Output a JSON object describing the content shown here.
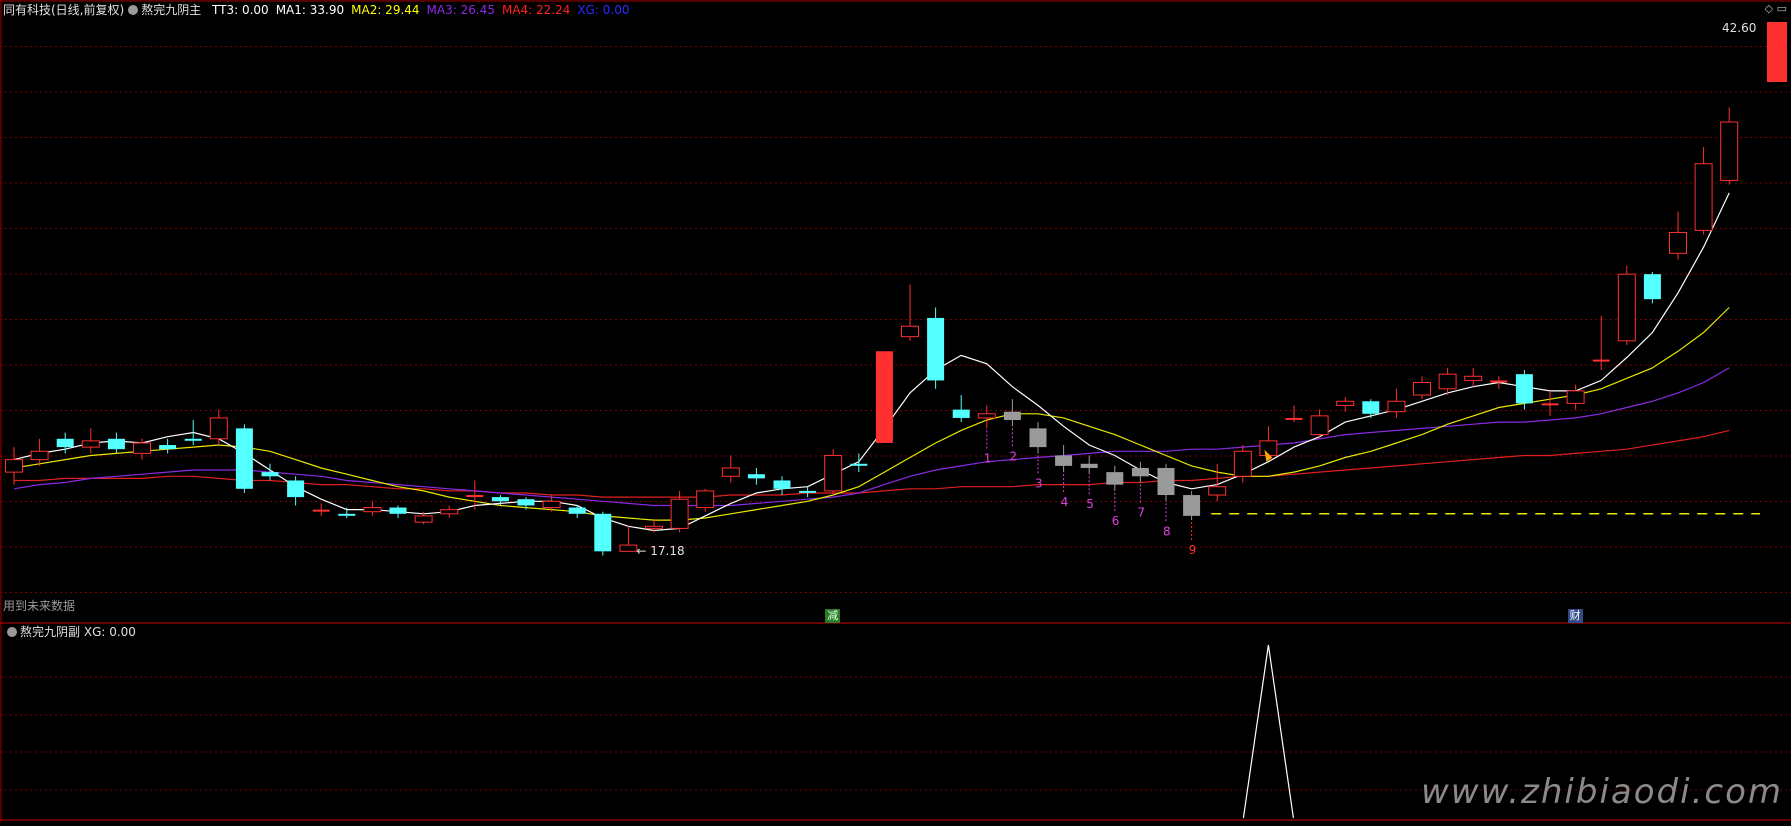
{
  "header": {
    "stock": "同有科技(日线,前复权)",
    "main_indicator": "熬完九阴主",
    "values": [
      {
        "label": "TT3: 0.00",
        "color": "#ffffff"
      },
      {
        "label": "MA1: 33.90",
        "color": "#ffffff"
      },
      {
        "label": "MA2: 29.44",
        "color": "#ffff00"
      },
      {
        "label": "MA3: 26.45",
        "color": "#8a2be2"
      },
      {
        "label": "MA4: 22.24",
        "color": "#ff2020"
      },
      {
        "label": "XG: 0.00",
        "color": "#2a2aff"
      }
    ],
    "corner_icons": "◇ ▭"
  },
  "sub_header": {
    "indicator": "熬完九阴副",
    "value": "XG: 0.00"
  },
  "labels": {
    "future_data": "用到未来数据",
    "high_price": "42.60",
    "low_price": "← 17.18",
    "badge_reduce": "减",
    "badge_wealth": "财",
    "watermark": "www.zhibiaodi.com"
  },
  "colors": {
    "up": "#ff3030",
    "down": "#54ffff",
    "grey": "#9a9a9a",
    "grid": "#7a0000",
    "ma1": "#ffffff",
    "ma2": "#e8e800",
    "ma3": "#8a2be2",
    "ma4": "#e02020",
    "count": "#e040e0",
    "count9": "#ff3030"
  },
  "chart_data": {
    "type": "candlestick",
    "ylim": [
      14,
      42.6
    ],
    "candles": [
      {
        "o": 21.0,
        "c": 21.6,
        "h": 22.2,
        "l": 20.4,
        "k": "up"
      },
      {
        "o": 21.6,
        "c": 22.0,
        "h": 22.6,
        "l": 21.3,
        "k": "up"
      },
      {
        "o": 22.6,
        "c": 22.2,
        "h": 22.9,
        "l": 21.9,
        "k": "down"
      },
      {
        "o": 22.2,
        "c": 22.5,
        "h": 23.1,
        "l": 21.9,
        "k": "up"
      },
      {
        "o": 22.6,
        "c": 22.1,
        "h": 22.9,
        "l": 21.9,
        "k": "down"
      },
      {
        "o": 21.9,
        "c": 22.4,
        "h": 22.6,
        "l": 21.6,
        "k": "up"
      },
      {
        "o": 22.3,
        "c": 22.1,
        "h": 22.6,
        "l": 21.9,
        "k": "down"
      },
      {
        "o": 22.6,
        "c": 22.6,
        "h": 23.5,
        "l": 22.3,
        "k": "doji"
      },
      {
        "o": 22.6,
        "c": 23.6,
        "h": 24.0,
        "l": 22.3,
        "k": "up"
      },
      {
        "o": 23.1,
        "c": 20.2,
        "h": 23.3,
        "l": 20.0,
        "k": "down"
      },
      {
        "o": 21.0,
        "c": 20.8,
        "h": 21.4,
        "l": 20.6,
        "k": "down"
      },
      {
        "o": 20.6,
        "c": 19.8,
        "h": 20.8,
        "l": 19.4,
        "k": "down"
      },
      {
        "o": 19.2,
        "c": 19.2,
        "h": 19.5,
        "l": 18.9,
        "k": "doji"
      },
      {
        "o": 19.0,
        "c": 19.0,
        "h": 19.3,
        "l": 18.8,
        "k": "doji"
      },
      {
        "o": 19.1,
        "c": 19.3,
        "h": 19.6,
        "l": 18.9,
        "k": "up"
      },
      {
        "o": 19.3,
        "c": 19.0,
        "h": 19.4,
        "l": 18.8,
        "k": "down"
      },
      {
        "o": 18.6,
        "c": 18.9,
        "h": 19.1,
        "l": 18.5,
        "k": "up"
      },
      {
        "o": 19.0,
        "c": 19.2,
        "h": 19.4,
        "l": 18.8,
        "k": "up"
      },
      {
        "o": 19.8,
        "c": 19.9,
        "h": 20.6,
        "l": 19.2,
        "k": "doji"
      },
      {
        "o": 19.8,
        "c": 19.6,
        "h": 19.9,
        "l": 19.4,
        "k": "down"
      },
      {
        "o": 19.7,
        "c": 19.4,
        "h": 19.8,
        "l": 19.2,
        "k": "down"
      },
      {
        "o": 19.3,
        "c": 19.6,
        "h": 19.9,
        "l": 19.1,
        "k": "up"
      },
      {
        "o": 19.3,
        "c": 19.0,
        "h": 19.4,
        "l": 18.8,
        "k": "down"
      },
      {
        "o": 19.0,
        "c": 17.2,
        "h": 19.1,
        "l": 17.0,
        "k": "down"
      },
      {
        "o": 17.5,
        "c": 17.2,
        "h": 18.4,
        "l": 17.18,
        "k": "up"
      },
      {
        "o": 18.3,
        "c": 18.4,
        "h": 18.7,
        "l": 18.1,
        "k": "up"
      },
      {
        "o": 18.3,
        "c": 19.7,
        "h": 20.1,
        "l": 18.1,
        "k": "up"
      },
      {
        "o": 19.3,
        "c": 20.1,
        "h": 20.2,
        "l": 19.1,
        "k": "up"
      },
      {
        "o": 20.8,
        "c": 21.2,
        "h": 21.8,
        "l": 20.5,
        "k": "up"
      },
      {
        "o": 20.9,
        "c": 20.7,
        "h": 21.2,
        "l": 20.4,
        "k": "down"
      },
      {
        "o": 20.6,
        "c": 20.2,
        "h": 20.8,
        "l": 19.9,
        "k": "down"
      },
      {
        "o": 20.1,
        "c": 20.1,
        "h": 20.3,
        "l": 19.8,
        "k": "doji"
      },
      {
        "o": 20.1,
        "c": 21.8,
        "h": 22.1,
        "l": 19.9,
        "k": "up"
      },
      {
        "o": 21.4,
        "c": 21.4,
        "h": 21.9,
        "l": 21.0,
        "k": "doji"
      },
      {
        "o": 22.4,
        "c": 26.8,
        "h": 26.8,
        "l": 22.4,
        "k": "limit"
      },
      {
        "o": 27.5,
        "c": 28.0,
        "h": 30.0,
        "l": 27.3,
        "k": "up"
      },
      {
        "o": 28.4,
        "c": 25.4,
        "h": 28.9,
        "l": 25.0,
        "k": "down"
      },
      {
        "o": 24.0,
        "c": 23.6,
        "h": 24.7,
        "l": 23.4,
        "k": "down"
      },
      {
        "o": 23.6,
        "c": 23.8,
        "h": 24.2,
        "l": 23.1,
        "k": "up"
      },
      {
        "o": 23.5,
        "c": 23.9,
        "h": 24.5,
        "l": 23.2,
        "k": "grey"
      },
      {
        "o": 23.1,
        "c": 22.2,
        "h": 23.4,
        "l": 21.9,
        "k": "grey"
      },
      {
        "o": 21.8,
        "c": 21.3,
        "h": 22.3,
        "l": 21.0,
        "k": "grey"
      },
      {
        "o": 21.4,
        "c": 21.2,
        "h": 21.8,
        "l": 20.9,
        "k": "grey"
      },
      {
        "o": 21.0,
        "c": 20.4,
        "h": 21.3,
        "l": 20.1,
        "k": "grey"
      },
      {
        "o": 21.2,
        "c": 20.8,
        "h": 21.5,
        "l": 20.5,
        "k": "grey"
      },
      {
        "o": 21.2,
        "c": 19.9,
        "h": 21.4,
        "l": 19.6,
        "k": "grey"
      },
      {
        "o": 19.9,
        "c": 18.9,
        "h": 20.1,
        "l": 18.7,
        "k": "grey"
      },
      {
        "o": 19.9,
        "c": 20.3,
        "h": 21.4,
        "l": 19.6,
        "k": "up"
      },
      {
        "o": 20.8,
        "c": 22.0,
        "h": 22.3,
        "l": 20.5,
        "k": "up"
      },
      {
        "o": 21.8,
        "c": 22.5,
        "h": 23.2,
        "l": 21.6,
        "k": "up"
      },
      {
        "o": 23.6,
        "c": 23.6,
        "h": 24.2,
        "l": 23.4,
        "k": "doji"
      },
      {
        "o": 22.8,
        "c": 23.7,
        "h": 24.0,
        "l": 22.6,
        "k": "up"
      },
      {
        "o": 24.2,
        "c": 24.4,
        "h": 24.6,
        "l": 23.9,
        "k": "up"
      },
      {
        "o": 24.4,
        "c": 23.8,
        "h": 24.5,
        "l": 23.6,
        "k": "down"
      },
      {
        "o": 23.9,
        "c": 24.4,
        "h": 25.0,
        "l": 23.6,
        "k": "up"
      },
      {
        "o": 24.7,
        "c": 25.3,
        "h": 25.6,
        "l": 24.5,
        "k": "up"
      },
      {
        "o": 25.0,
        "c": 25.7,
        "h": 26.0,
        "l": 24.7,
        "k": "up"
      },
      {
        "o": 25.4,
        "c": 25.6,
        "h": 26.0,
        "l": 25.1,
        "k": "up"
      },
      {
        "o": 25.4,
        "c": 25.3,
        "h": 25.6,
        "l": 25.0,
        "k": "doji"
      },
      {
        "o": 25.7,
        "c": 24.3,
        "h": 25.9,
        "l": 24.0,
        "k": "down"
      },
      {
        "o": 24.3,
        "c": 24.3,
        "h": 24.9,
        "l": 23.7,
        "k": "doji"
      },
      {
        "o": 24.3,
        "c": 24.9,
        "h": 25.2,
        "l": 24.0,
        "k": "up"
      },
      {
        "o": 26.4,
        "c": 26.4,
        "h": 28.5,
        "l": 25.9,
        "k": "doji"
      },
      {
        "o": 27.3,
        "c": 30.5,
        "h": 30.9,
        "l": 27.1,
        "k": "up"
      },
      {
        "o": 30.5,
        "c": 29.3,
        "h": 30.6,
        "l": 29.1,
        "k": "down"
      },
      {
        "o": 31.5,
        "c": 32.5,
        "h": 33.5,
        "l": 31.2,
        "k": "up"
      },
      {
        "o": 32.6,
        "c": 35.8,
        "h": 36.6,
        "l": 32.4,
        "k": "up"
      },
      {
        "o": 35.0,
        "c": 37.8,
        "h": 38.5,
        "l": 34.8,
        "k": "up"
      }
    ],
    "ma1": [
      21.6,
      21.9,
      22.1,
      22.4,
      22.5,
      22.4,
      22.7,
      22.9,
      22.6,
      21.9,
      21.1,
      20.3,
      19.7,
      19.2,
      19.2,
      19.1,
      19.0,
      19.1,
      19.4,
      19.5,
      19.6,
      19.6,
      19.4,
      18.8,
      18.4,
      18.2,
      18.3,
      18.9,
      19.5,
      20.0,
      20.2,
      20.3,
      20.9,
      21.5,
      23.1,
      24.8,
      25.9,
      26.6,
      26.2,
      25.1,
      24.2,
      23.2,
      22.3,
      21.8,
      21.1,
      20.5,
      20.2,
      20.4,
      20.9,
      21.5,
      22.2,
      22.7,
      23.4,
      23.7,
      24.0,
      24.4,
      24.8,
      25.1,
      25.3,
      25.1,
      24.9,
      24.9,
      25.4,
      26.5,
      27.7,
      29.6,
      31.8,
      34.4
    ],
    "ma2": [
      21.2,
      21.4,
      21.6,
      21.8,
      21.9,
      22.0,
      22.1,
      22.2,
      22.3,
      22.2,
      22.0,
      21.6,
      21.2,
      20.9,
      20.6,
      20.3,
      20.1,
      19.8,
      19.6,
      19.4,
      19.3,
      19.2,
      19.1,
      18.9,
      18.8,
      18.7,
      18.7,
      18.8,
      19.0,
      19.2,
      19.4,
      19.6,
      19.9,
      20.3,
      21.0,
      21.7,
      22.4,
      23.0,
      23.5,
      23.8,
      23.8,
      23.6,
      23.2,
      22.8,
      22.3,
      21.8,
      21.3,
      21.0,
      20.8,
      20.8,
      21.0,
      21.3,
      21.7,
      22.0,
      22.4,
      22.8,
      23.3,
      23.7,
      24.1,
      24.3,
      24.5,
      24.7,
      25.0,
      25.5,
      26.0,
      26.8,
      27.7,
      28.9
    ],
    "ma3": [
      20.2,
      20.4,
      20.5,
      20.7,
      20.8,
      20.9,
      21.0,
      21.1,
      21.1,
      21.1,
      21.0,
      20.9,
      20.8,
      20.6,
      20.5,
      20.4,
      20.3,
      20.2,
      20.1,
      20.0,
      19.9,
      19.8,
      19.7,
      19.6,
      19.5,
      19.4,
      19.4,
      19.4,
      19.4,
      19.5,
      19.6,
      19.7,
      19.8,
      20.0,
      20.4,
      20.8,
      21.1,
      21.3,
      21.5,
      21.6,
      21.7,
      21.8,
      21.9,
      22.0,
      22.0,
      22.0,
      22.1,
      22.1,
      22.2,
      22.3,
      22.4,
      22.6,
      22.8,
      22.9,
      23.0,
      23.1,
      23.2,
      23.3,
      23.4,
      23.4,
      23.5,
      23.6,
      23.8,
      24.1,
      24.4,
      24.8,
      25.3,
      26.0
    ],
    "ma4": [
      20.6,
      20.6,
      20.7,
      20.7,
      20.7,
      20.7,
      20.8,
      20.8,
      20.7,
      20.6,
      20.6,
      20.5,
      20.4,
      20.4,
      20.3,
      20.2,
      20.2,
      20.1,
      20.1,
      20.0,
      20.0,
      19.9,
      19.9,
      19.8,
      19.8,
      19.8,
      19.8,
      19.8,
      19.9,
      19.9,
      19.9,
      20.0,
      20.0,
      20.0,
      20.1,
      20.2,
      20.2,
      20.3,
      20.3,
      20.3,
      20.4,
      20.4,
      20.4,
      20.5,
      20.5,
      20.6,
      20.6,
      20.7,
      20.8,
      20.8,
      20.9,
      21.0,
      21.1,
      21.2,
      21.3,
      21.4,
      21.5,
      21.6,
      21.7,
      21.8,
      21.8,
      21.9,
      22.0,
      22.1,
      22.3,
      22.5,
      22.7,
      23.0
    ],
    "count_labels": [
      {
        "idx": 38,
        "text": "1"
      },
      {
        "idx": 39,
        "text": "2"
      },
      {
        "idx": 40,
        "text": "3"
      },
      {
        "idx": 41,
        "text": "4"
      },
      {
        "idx": 42,
        "text": "5"
      },
      {
        "idx": 43,
        "text": "6"
      },
      {
        "idx": 44,
        "text": "7"
      },
      {
        "idx": 45,
        "text": "8"
      },
      {
        "idx": 46,
        "text": "9"
      }
    ],
    "dashed_level": 19.0,
    "dashed_from_idx": 47,
    "badges": [
      {
        "idx": 32,
        "key": "badge_reduce",
        "bg": "#2a7a2a",
        "fg": "#e0ffe0"
      },
      {
        "idx": 61,
        "key": "badge_wealth",
        "bg": "#334a88",
        "fg": "#ffffff"
      }
    ],
    "sub_xg": {
      "signal_idx": 49,
      "ylim": [
        0,
        1
      ]
    }
  }
}
